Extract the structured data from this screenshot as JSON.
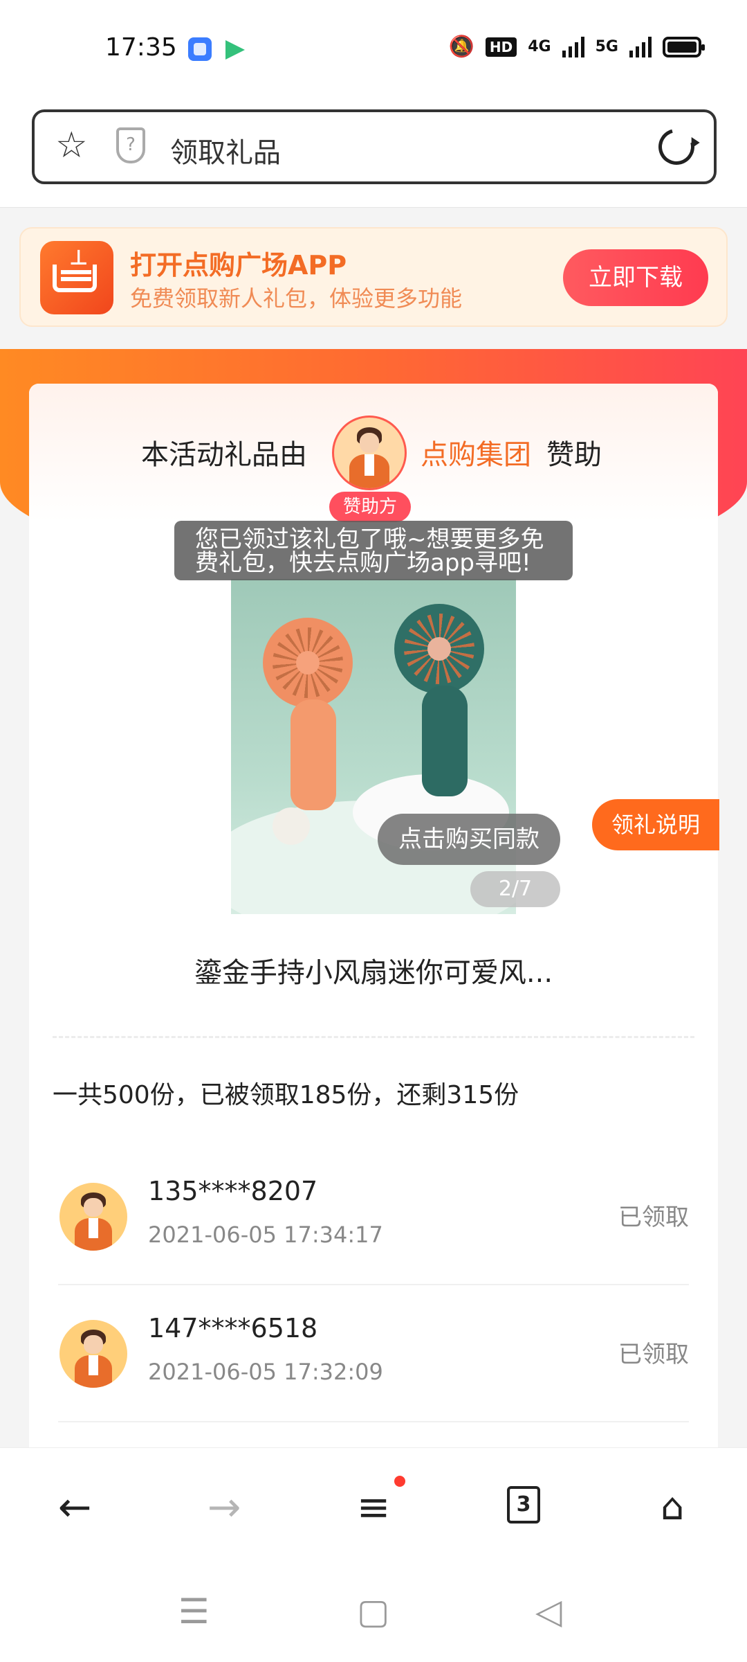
{
  "status_bar": {
    "time": "17:35",
    "hd_label": "HD",
    "net1": "4G",
    "net2": "5G",
    "icons": [
      "mute-bell-icon",
      "signal-icon",
      "battery-icon"
    ]
  },
  "browser": {
    "page_title": "领取礼品",
    "icons": [
      "star-icon",
      "shield-question-icon",
      "reload-icon"
    ]
  },
  "banner": {
    "title": "打开点购广场APP",
    "subtitle": "免费领取新人礼包，体验更多功能",
    "download_label": "立即下载"
  },
  "sponsor": {
    "prefix": "本活动礼品由",
    "name": "点购集团",
    "suffix": "赞助",
    "tag": "赞助方"
  },
  "product": {
    "toast": "您已领过该礼包了哦~想要更多免费礼包，快去点购广场app寻吧!",
    "buy_same_label": "点击购买同款",
    "pager": "2/7",
    "rules_label": "领礼说明",
    "name": "鎏金手持小风扇迷你可爱风..."
  },
  "summary": "一共500份，已被领取185份，还剩315份",
  "records": [
    {
      "phone": "135****8207",
      "time": "2021-06-05 17:34:17",
      "status": "已领取"
    },
    {
      "phone": "147****6518",
      "time": "2021-06-05 17:32:09",
      "status": "已领取"
    }
  ],
  "bottom_nav": {
    "tab_count": "3",
    "icons": [
      "back-arrow-icon",
      "forward-arrow-icon",
      "menu-icon",
      "tabs-icon",
      "home-icon"
    ]
  },
  "system_nav": {
    "icons": [
      "recent-apps-icon",
      "home-square-icon",
      "back-triangle-icon"
    ]
  }
}
